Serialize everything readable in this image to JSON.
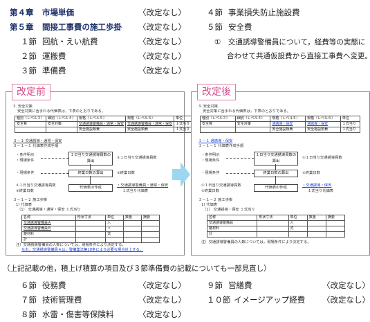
{
  "top_left": [
    {
      "num": "第４章",
      "title": "市場単価",
      "note": "〈改定なし〉"
    },
    {
      "num": "第５章",
      "title": "間接工事費の施工歩掛",
      "note": "〈改定なし〉"
    },
    {
      "num": "１節",
      "title": "回航・えい航費",
      "note": "〈改定なし〉"
    },
    {
      "num": "２節",
      "title": "運搬費",
      "note": "〈改定なし〉"
    },
    {
      "num": "３節",
      "title": "準備費",
      "note": "〈改定なし〉"
    }
  ],
  "top_right": {
    "s4": {
      "num": "４節",
      "title": "事業損失防止施設費"
    },
    "s5": {
      "num": "５節",
      "title": "安全費"
    },
    "note_line1": "①　交通誘導警備員について，経費等の実態に",
    "note_line2": "合わせて共通仮設費から直接工事費へ変更。"
  },
  "before": {
    "label": "改定前",
    "sec3": "3.  安全対策",
    "sec3b": "安全対策に含まれる代価表は，下表のとおりである。",
    "tbl_head": [
      "種別（レベル３）",
      "細別（レベル４）",
      "規格（レベル５）",
      "規格（レベル６）",
      "単位"
    ],
    "tbl_r1": [
      "安全費",
      "安全対策",
      "交通誘導警備員・通常・保安",
      "交通誘導警備員・通常・保安",
      "１式当り"
    ],
    "tbl_r2": [
      "",
      "",
      "安全施設類費",
      "安全施設類費",
      "１式当り"
    ],
    "h31": "３－１  交通誘導・通常・保安",
    "h311": "３－１－１  代価表作成手順",
    "flow": [
      "・条件明示",
      "・現場条件",
      "１日当り交通誘導員数の算出",
      "①１日当り交通誘導員数",
      "・現場条件",
      "終業日数の算出",
      "②終業日数",
      "①１日当り交通誘導員数",
      "②終業日数",
      "代価表の作成",
      "・交通誘導警備員・通常・保安",
      "１式当り代価表"
    ],
    "h312": "３－１－２  施工歩掛",
    "daika": "1)  代価表",
    "daika_t": "（1）  交通誘導・通常・保安    １式当り",
    "mtbl_head": [
      "名称",
      "形状寸法",
      "単位",
      "数量",
      "摘要"
    ],
    "mtbl_r1": [
      "交通誘導警備員Ａ",
      "",
      "人",
      "",
      ""
    ],
    "mtbl_r2": [
      "交通誘導警備員Ｂ",
      "",
      "〃",
      "",
      ""
    ],
    "mtbl_r3": [
      "雑材料",
      "",
      "式",
      "",
      ""
    ],
    "mtbl_r4": [
      "計",
      "",
      "",
      "",
      ""
    ],
    "note": "注）交通誘導警備員の人数については，現場条件により決定する。",
    "note2": "なお，交通誘導警備員Ａは，警備業法第18条により必要な場合計上する。"
  },
  "after": {
    "label": "改定後",
    "sec3": "3.  安全対策",
    "sec3b": "安全対策に含まれる代価表は，下表のとおりである。",
    "tbl_head": [
      "種別（レベル３）",
      "細別（レベル４）",
      "規格（レベル５）",
      "規格（レベル６）",
      "単位"
    ],
    "tbl_r1": [
      "安全費",
      "安全対策",
      "通誘導・保安",
      "通誘導・保安",
      "１式当り"
    ],
    "tbl_r2": [
      "",
      "",
      "安全施設類費",
      "安全施設類費",
      "１式当り"
    ],
    "h31": "３－１  通誘導・保安",
    "h311": "３－１－１  代価表作成手順",
    "flow": [
      "・条件明示",
      "・現場条件",
      "１日当り交通誘導員数の算出",
      "①１日当り交通誘導員数",
      "・現場条件",
      "終業日数の算出",
      "②終業日数",
      "①１日当り交通誘導員数",
      "②終業日数",
      "代価表の作成",
      "・交通誘導・保安",
      "１式当り代価表"
    ],
    "h312": "３－１－２  施工歩掛",
    "daika": "1)  代価表",
    "daika_t": "（1）  交通誘導・保安    １式当り",
    "mtbl_head": [
      "名称",
      "形状寸法",
      "単位",
      "数量",
      "摘要"
    ],
    "mtbl_r1": [
      "交通誘導警備員",
      "",
      "人",
      "",
      ""
    ],
    "mtbl_r2": [
      "雑材料",
      "",
      "式",
      "",
      ""
    ],
    "mtbl_r3": [
      "計",
      "",
      "",
      "",
      ""
    ],
    "note": "注）交通誘導警備員の人数については，現場条件により決定する。"
  },
  "footer_intro": "（上記記載の他，積上げ積算の項目及び３節準備費の記載についても一部見直し）",
  "bottom_left": [
    {
      "num": "６節",
      "title": "役務費",
      "note": "〈改定なし〉"
    },
    {
      "num": "７節",
      "title": "技術管理費",
      "note": "〈改定なし〉"
    },
    {
      "num": "８節",
      "title": "水雷・傷害等保険料",
      "note": "〈改定なし〉"
    }
  ],
  "bottom_right": [
    {
      "num": "９節",
      "title": "営繕費",
      "note": "〈改定なし〉"
    },
    {
      "num": "１０節",
      "title": "イメージアップ経費",
      "note": "〈改定なし〉"
    }
  ]
}
